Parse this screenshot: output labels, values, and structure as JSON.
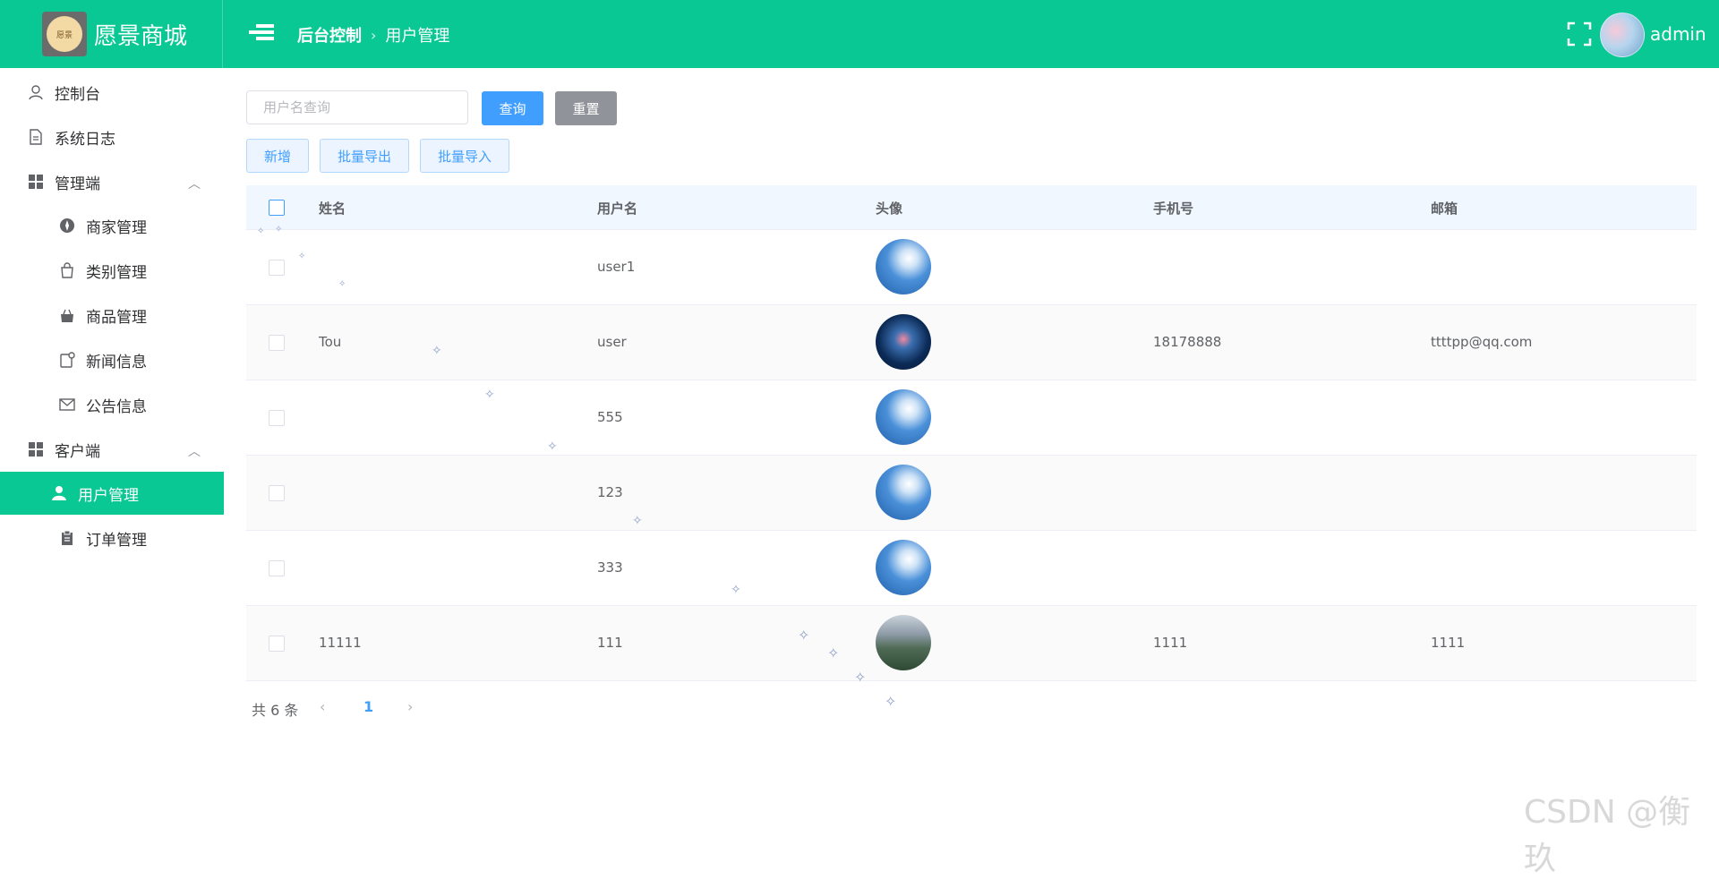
{
  "header": {
    "brand": "愿景商城",
    "logo_text": "愿景",
    "breadcrumb_home": "后台控制",
    "breadcrumb_sep": "›",
    "breadcrumb_current": "用户管理",
    "admin_name": "admin"
  },
  "sidebar": {
    "items": [
      {
        "label": "控制台",
        "icon": "user-outline-icon"
      },
      {
        "label": "系统日志",
        "icon": "document-icon"
      },
      {
        "label": "管理端",
        "icon": "grid-icon",
        "expanded": true
      },
      {
        "label": "商家管理",
        "icon": "compass-icon"
      },
      {
        "label": "类别管理",
        "icon": "bag-icon"
      },
      {
        "label": "商品管理",
        "icon": "shopping-bag-icon"
      },
      {
        "label": "新闻信息",
        "icon": "news-icon"
      },
      {
        "label": "公告信息",
        "icon": "mail-icon"
      },
      {
        "label": "客户端",
        "icon": "grid-icon",
        "expanded": true
      },
      {
        "label": "用户管理",
        "icon": "user-filled-icon",
        "active": true
      },
      {
        "label": "订单管理",
        "icon": "clipboard-icon"
      }
    ]
  },
  "toolbar": {
    "search_placeholder": "用户名查询",
    "query_label": "查询",
    "reset_label": "重置",
    "add_label": "新增",
    "export_label": "批量导出",
    "import_label": "批量导入"
  },
  "table": {
    "columns": [
      "姓名",
      "用户名",
      "头像",
      "手机号",
      "邮箱"
    ],
    "rows": [
      {
        "name": "",
        "username": "user1",
        "avatar": "sky",
        "phone": "",
        "email": ""
      },
      {
        "name": "Tou",
        "username": "user",
        "avatar": "dark",
        "phone": "18178888",
        "email": "ttttpp@qq.com"
      },
      {
        "name": "",
        "username": "555",
        "avatar": "sky",
        "phone": "",
        "email": ""
      },
      {
        "name": "",
        "username": "123",
        "avatar": "sky",
        "phone": "",
        "email": ""
      },
      {
        "name": "",
        "username": "333",
        "avatar": "sky",
        "phone": "",
        "email": ""
      },
      {
        "name": "11111",
        "username": "111",
        "avatar": "mountain",
        "phone": "1111",
        "email": "1111"
      }
    ]
  },
  "pagination": {
    "total_text": "共 6 条",
    "current_page": "1",
    "prev": "‹",
    "next": "›"
  },
  "watermark": "CSDN @衡玖",
  "colors": {
    "primary_green": "#09c894",
    "primary_blue": "#409eff",
    "reset_gray": "#909399"
  }
}
